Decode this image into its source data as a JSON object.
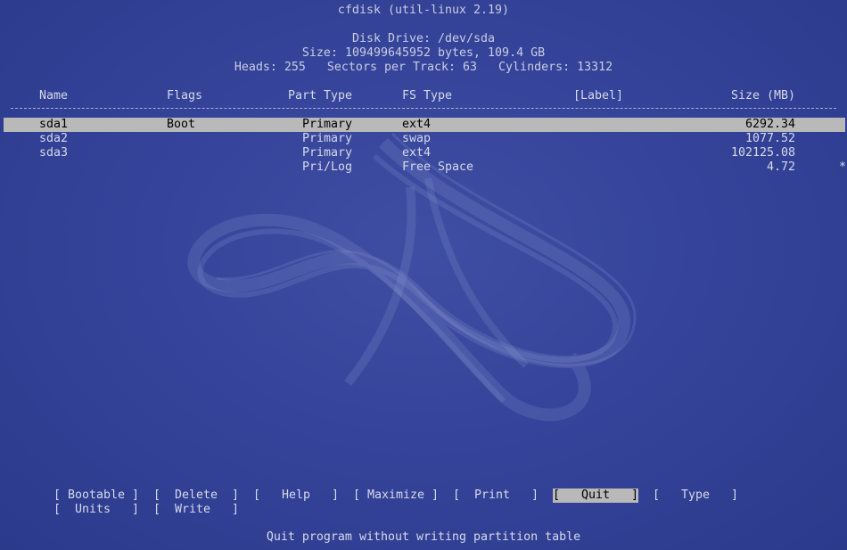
{
  "title": "cfdisk (util-linux 2.19)",
  "disk": {
    "drive_line": "Disk Drive: /dev/sda",
    "size_line": "Size: 109499645952 bytes, 109.4 GB",
    "geometry_line": "Heads: 255   Sectors per Track: 63   Cylinders: 13312"
  },
  "columns": {
    "name": "Name",
    "flags": "Flags",
    "part_type": "Part Type",
    "fs_type": "FS Type",
    "label": "[Label]",
    "size": "Size (MB)"
  },
  "partitions": [
    {
      "name": "sda1",
      "flags": "Boot",
      "part_type": " Primary",
      "fs_type": "ext4",
      "size": "6292.34"
    },
    {
      "name": "sda2",
      "flags": "",
      "part_type": " Primary",
      "fs_type": "swap",
      "size": "1077.52"
    },
    {
      "name": "sda3",
      "flags": "",
      "part_type": " Primary",
      "fs_type": "ext4",
      "size": "102125.08"
    },
    {
      "name": "",
      "flags": "",
      "part_type": " Pri/Log",
      "fs_type": "Free Space",
      "size": "4.72",
      "marker": "*"
    }
  ],
  "menu": [
    {
      "label": "[ Bootable ]"
    },
    {
      "label": "[  Delete  ]"
    },
    {
      "label": "[   Help   ]"
    },
    {
      "label": "[ Maximize ]"
    },
    {
      "label": "[  Print   ]"
    },
    {
      "label": "[   Quit   ]",
      "active": true
    },
    {
      "label": "[   Type   ]"
    },
    {
      "label": "[  Units   ]"
    },
    {
      "label": "[  Write   ]"
    }
  ],
  "status_text": "Quit program without writing partition table",
  "colors": {
    "background": "#35449a",
    "text": "#d6d9ea",
    "highlight_bg": "#b9b9b9",
    "highlight_fg": "#000000"
  }
}
